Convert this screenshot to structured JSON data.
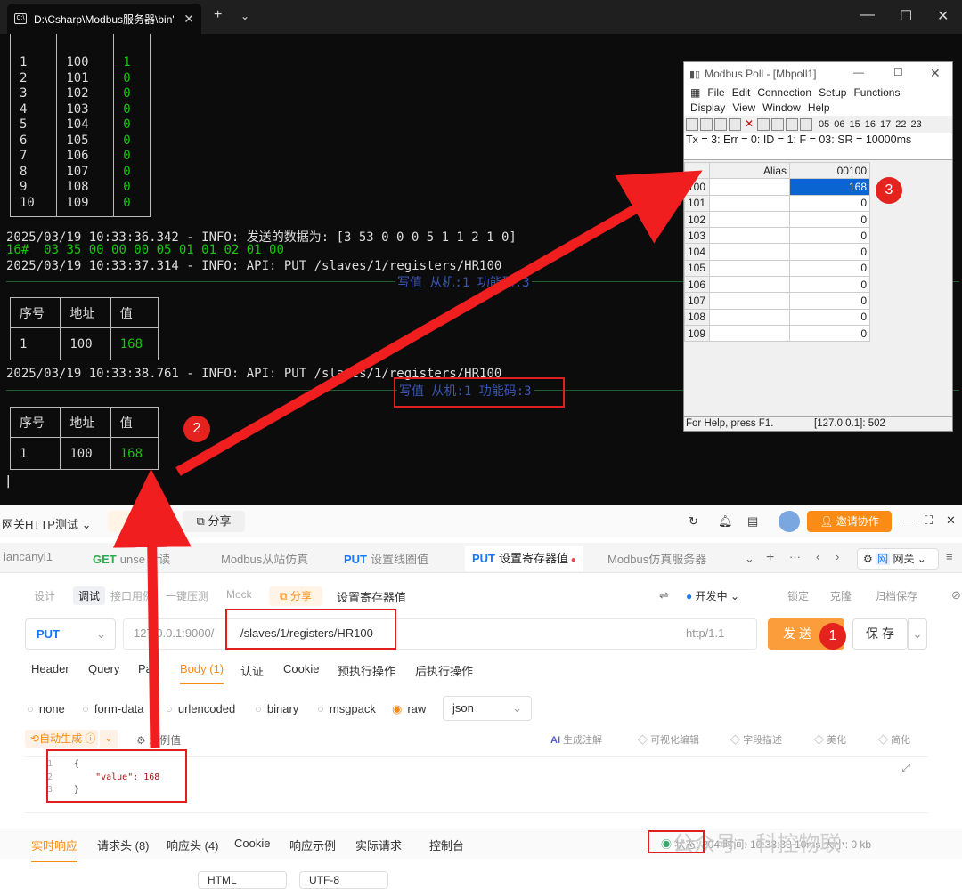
{
  "terminal": {
    "tab_title": "D:\\Csharp\\Modbus服务器\\bin'",
    "tab_icon": "terminal-icon",
    "table1_rows": [
      [
        "1",
        "100",
        "1"
      ],
      [
        "2",
        "101",
        "0"
      ],
      [
        "3",
        "102",
        "0"
      ],
      [
        "4",
        "103",
        "0"
      ],
      [
        "5",
        "104",
        "0"
      ],
      [
        "6",
        "105",
        "0"
      ],
      [
        "7",
        "106",
        "0"
      ],
      [
        "8",
        "107",
        "0"
      ],
      [
        "9",
        "108",
        "0"
      ],
      [
        "10",
        "109",
        "0"
      ]
    ],
    "log1": "2025/03/19 10:33:36.342 - INFO: 发送的数据为: [3 53 0 0 0 5 1 1 2 1 0]",
    "hex_prefix": "16#",
    "hex_bytes": "  03 35 00 00 00 05 01 01 02 01 00",
    "log2": "2025/03/19 10:33:37.314 - INFO: API: PUT /slaves/1/registers/HR100",
    "sep_label1": "写值 从机:1 功能码:3",
    "table_headers": [
      "序号",
      "地址",
      "值"
    ],
    "table2_row": [
      "1",
      "100",
      "168"
    ],
    "log3": "2025/03/19 10:33:38.761 - INFO: API: PUT /slaves/1/registers/HR100",
    "sep_label2": "写值 从机:1 功能码:3",
    "table3_row": [
      "1",
      "100",
      "168"
    ],
    "cursor": "|"
  },
  "modbus_poll": {
    "title": "Modbus Poll - [Mbpoll1]",
    "menu1": [
      "File",
      "Edit",
      "Connection",
      "Setup",
      "Functions"
    ],
    "menu2": [
      "Display",
      "View",
      "Window",
      "Help"
    ],
    "toolbar_numbers": [
      "05",
      "06",
      "15",
      "16",
      "17",
      "22",
      "23"
    ],
    "tx_line": "Tx = 3: Err = 0: ID = 1: F = 03: SR = 10000ms",
    "col_alias": "Alias",
    "col_addr": "00100",
    "rows": [
      {
        "addr": "100",
        "value": "168"
      },
      {
        "addr": "101",
        "value": "0"
      },
      {
        "addr": "102",
        "value": "0"
      },
      {
        "addr": "103",
        "value": "0"
      },
      {
        "addr": "104",
        "value": "0"
      },
      {
        "addr": "105",
        "value": "0"
      },
      {
        "addr": "106",
        "value": "0"
      },
      {
        "addr": "107",
        "value": "0"
      },
      {
        "addr": "108",
        "value": "0"
      },
      {
        "addr": "109",
        "value": "0"
      }
    ],
    "status_help": "For Help, press F1.",
    "status_conn": "[127.0.0.1]: 502"
  },
  "apifox": {
    "workspace": "网关HTTP测试",
    "new_label": "+ 新",
    "share_label": "分享",
    "invite_label": "邀请协作",
    "tabs": [
      {
        "label": "iancanyi1"
      },
      {
        "method": "GET",
        "label": "unse    er读"
      },
      {
        "label": "Modbus从站仿真"
      },
      {
        "method": "PUT",
        "label": "设置线圈值"
      },
      {
        "method": "PUT",
        "label": "设置寄存器值"
      },
      {
        "label": "Modbus仿真服务器"
      }
    ],
    "env_label": "网关",
    "subtabs": [
      "设计",
      "调试",
      "接口用例",
      "一键压测",
      "Mock"
    ],
    "subtab_share": "分享",
    "api_name": "设置寄存器值",
    "dev_status": "开发中",
    "actions": [
      "锁定",
      "克隆",
      "归档保存"
    ],
    "method": "PUT",
    "base_url": "127.0.0.1:9000/",
    "path": "/slaves/1/registers/HR100",
    "http_version": "http/1.1",
    "send_label": "发 送",
    "save_label": "保 存",
    "req_tabs": [
      "Header",
      "Query",
      "Pa",
      "Body (1)",
      "认证",
      "Cookie",
      "预执行操作",
      "后执行操作"
    ],
    "body_types": [
      "none",
      "form-data",
      "urlencoded",
      "binary",
      "msgpack",
      "raw"
    ],
    "body_format": "json",
    "auto_gen": "自动生成",
    "example_label": "示例值",
    "tools": [
      "生成注解",
      "可视化编辑",
      "字段描述",
      "美化",
      "简化"
    ],
    "code_lines": [
      "{",
      "    \"value\": 168",
      "}"
    ],
    "resp_tabs": [
      "实时响应",
      "请求头 (8)",
      "响应头 (4)",
      "Cookie",
      "响应示例",
      "实际请求",
      "控制台"
    ],
    "status_text": "状态: 204  时间: 10:33:38  10ms  大小: 0 kb",
    "bottom_items": [
      "HTML",
      "UTF-8"
    ],
    "watermark": "公众号 · 科控物联"
  },
  "badges": [
    "1",
    "2",
    "3"
  ],
  "colors": {
    "terminal_bg": "#0c0c0c",
    "green": "#16c60c",
    "orange": "#fa8c16",
    "red": "#e02020",
    "put_blue": "#1677ff"
  }
}
